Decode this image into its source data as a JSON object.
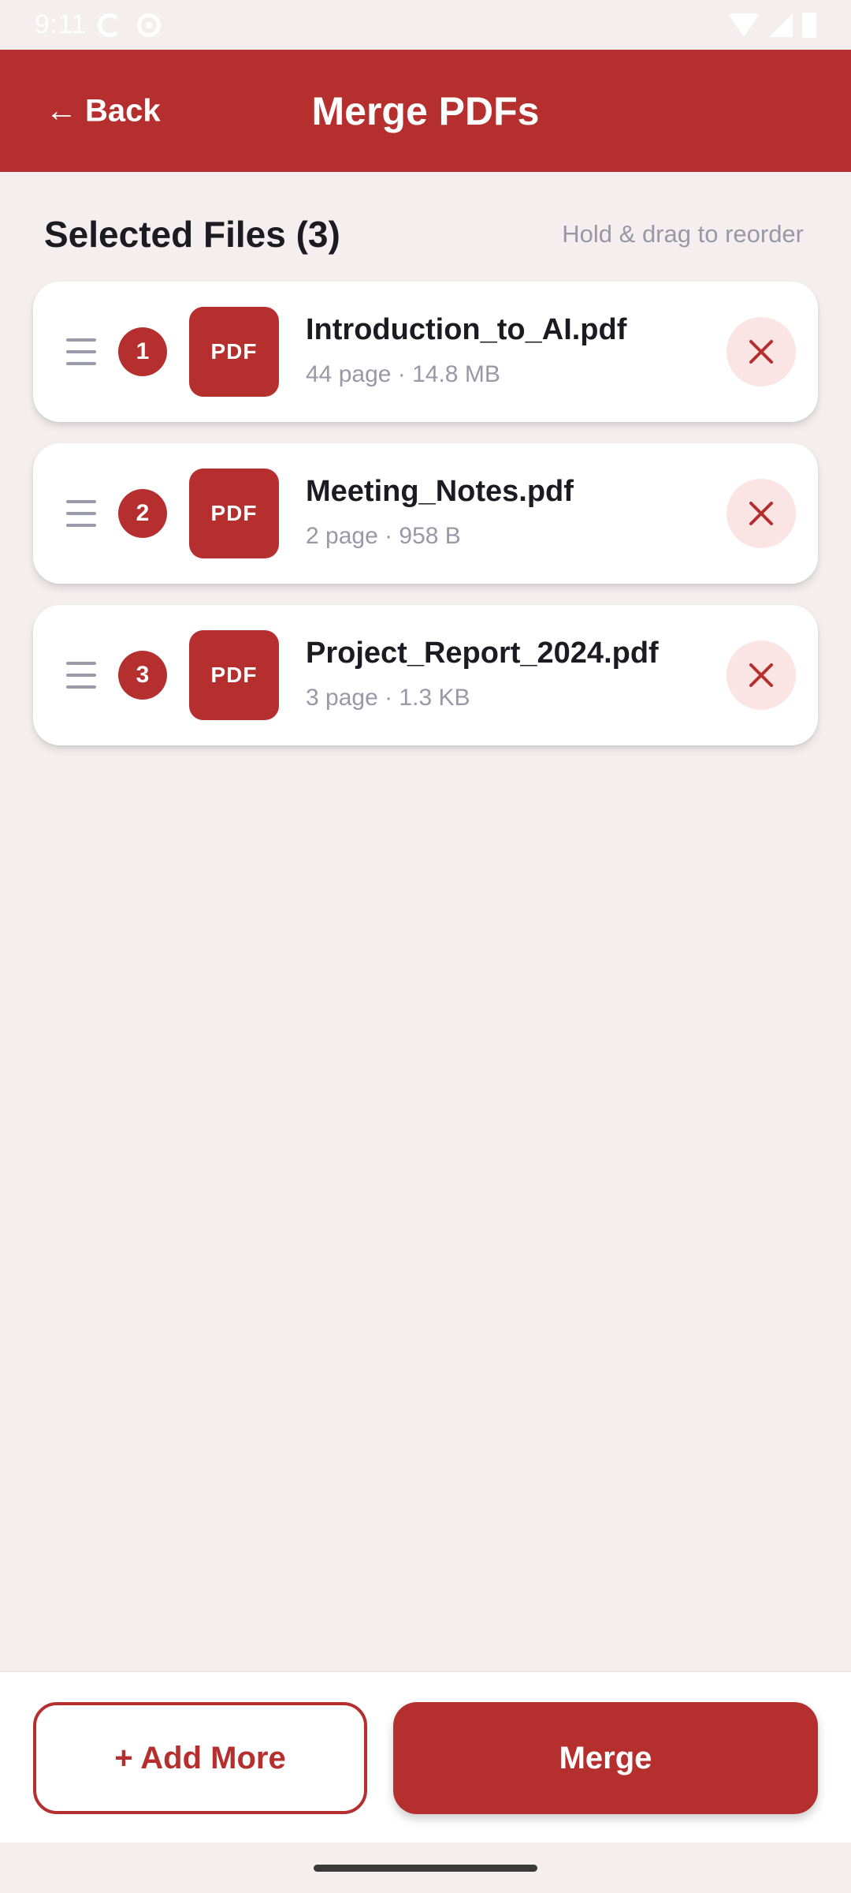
{
  "status_bar": {
    "time": "9:11"
  },
  "header": {
    "back_label": "Back",
    "back_arrow": "←",
    "title": "Merge PDFs"
  },
  "section": {
    "title": "Selected Files (3)",
    "hint": "Hold & drag to reorder"
  },
  "files": [
    {
      "index": "1",
      "thumb_label": "PDF",
      "name": "Introduction_to_AI.pdf",
      "meta": "44 page · 14.8 MB"
    },
    {
      "index": "2",
      "thumb_label": "PDF",
      "name": "Meeting_Notes.pdf",
      "meta": "2 page · 958 B"
    },
    {
      "index": "3",
      "thumb_label": "PDF",
      "name": "Project_Report_2024.pdf",
      "meta": "3 page · 1.3 KB"
    }
  ],
  "footer": {
    "add_more_label": "+ Add More",
    "merge_label": "Merge"
  },
  "colors": {
    "accent": "#b52f2e",
    "background": "#f4eeef",
    "remove_bg": "#fbe4e4",
    "text_primary": "#1c1b22",
    "text_secondary": "#9a98a6"
  },
  "icons": {
    "back": "arrow-left-icon",
    "drag": "drag-handle-icon",
    "remove": "close-icon",
    "file": "pdf-file-icon"
  }
}
